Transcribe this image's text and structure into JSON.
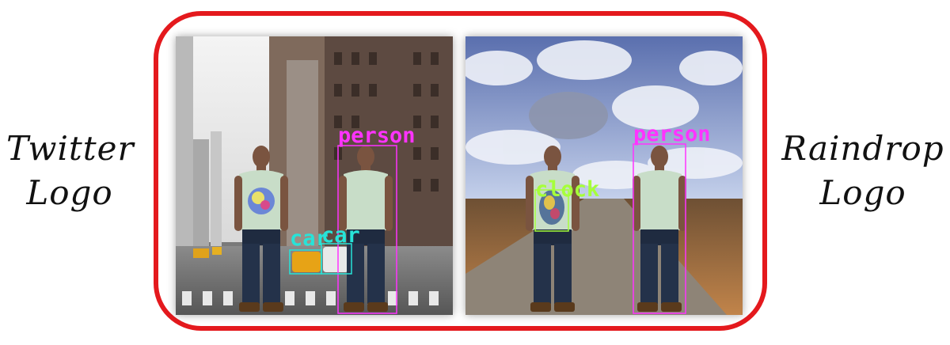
{
  "left_caption": {
    "line1": "Twitter",
    "line2": "Logo"
  },
  "right_caption": {
    "line1": "Raindrop",
    "line2": "Logo"
  },
  "colors": {
    "frame": "#e4191d",
    "person_box": "#ff33ff",
    "car_box": "#27e3d8",
    "clock_box": "#a6ff3a"
  },
  "street_panel": {
    "detections": [
      {
        "label": "person",
        "class": "person"
      },
      {
        "label": "car",
        "class": "car"
      },
      {
        "label": "car",
        "class": "car"
      }
    ]
  },
  "road_panel": {
    "detections": [
      {
        "label": "clock",
        "class": "clock"
      },
      {
        "label": "person",
        "class": "person"
      }
    ]
  }
}
